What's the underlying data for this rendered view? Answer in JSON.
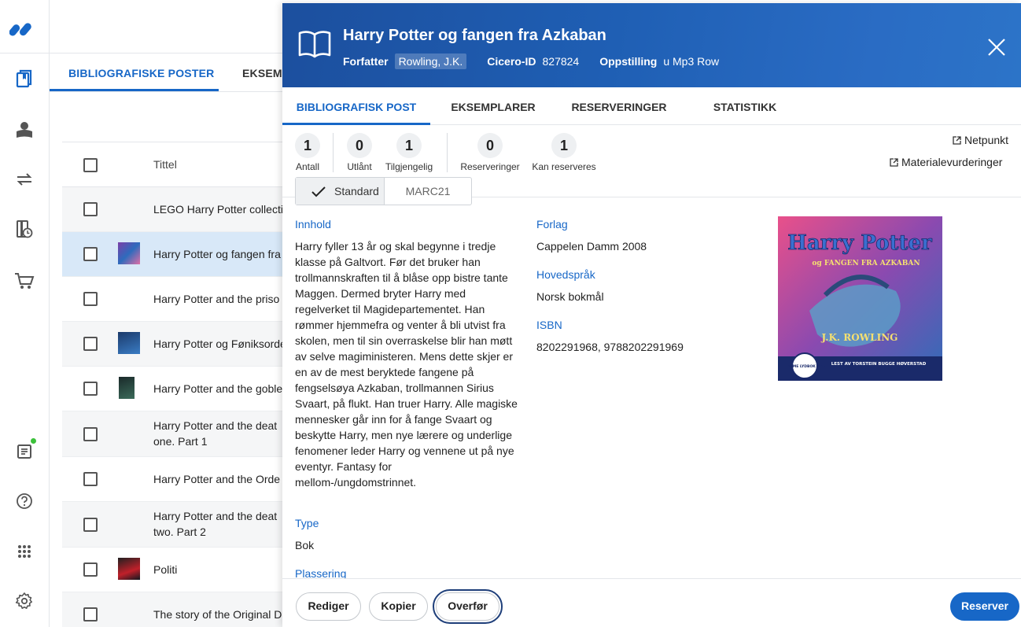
{
  "rail": {
    "icons": [
      "logo-icon",
      "catalog-icon",
      "patron-icon",
      "circulation-icon",
      "history-icon",
      "acquisition-icon",
      "report-icon",
      "help-icon",
      "apps-icon",
      "settings-icon"
    ]
  },
  "background": {
    "tabs": [
      "BIBLIOGRAFISKE POSTER",
      "EKSEMPLARER"
    ],
    "list_header": "Tittel",
    "rows": [
      {
        "title": "LEGO Harry Potter collecti",
        "line2": ""
      },
      {
        "title": "Harry Potter og fangen fra",
        "line2": ""
      },
      {
        "title": "Harry Potter and the priso",
        "line2": ""
      },
      {
        "title": "Harry Potter og Føniksorde",
        "line2": ""
      },
      {
        "title": "Harry Potter and the goble",
        "line2": ""
      },
      {
        "title": "Harry Potter and the deat",
        "line2": "one. Part 1"
      },
      {
        "title": "Harry Potter and the Orde",
        "line2": ""
      },
      {
        "title": "Harry Potter and the deat",
        "line2": "two. Part 2"
      },
      {
        "title": "Politi",
        "line2": ""
      },
      {
        "title": "The story of the Original D",
        "line2": ""
      }
    ]
  },
  "panel": {
    "title": "Harry Potter og fangen fra Azkaban",
    "meta": {
      "author_label": "Forfatter",
      "author": "Rowling, J.K.",
      "cicero_label": "Cicero-ID",
      "cicero_id": "827824",
      "placement_label": "Oppstilling",
      "placement": "u Mp3 Row"
    },
    "tabs": [
      "BIBLIOGRAFISK POST",
      "EKSEMPLARER",
      "RESERVERINGER",
      "STATISTIKK"
    ],
    "stats": [
      {
        "value": "1",
        "label": "Antall"
      },
      {
        "value": "0",
        "label": "Utlånt"
      },
      {
        "value": "1",
        "label": "Tilgjengelig"
      },
      {
        "value": "0",
        "label": "Reserveringer"
      },
      {
        "value": "1",
        "label": "Kan reserveres"
      }
    ],
    "links": {
      "netpunkt": "Netpunkt",
      "materialevurderinger": "Materialevurderinger"
    },
    "view_toggle": {
      "standard": "Standard",
      "marc": "MARC21"
    },
    "fields": {
      "innhold_label": "Innhold",
      "innhold_lines": [
        "Harry fyller 13 år og skal begynne i tredje",
        "klasse på Galtvort. Før det bruker han",
        "trollmannskraften til å blåse opp bistre tante",
        "Maggen. Dermed bryter Harry med",
        "regelverket til Magidepartementet. Han",
        "rømmer hjemmefra og venter å bli utvist fra",
        "skolen, men til sin overraskelse blir han møtt",
        "av selve magiministeren. Mens dette skjer er",
        "en av de mest beryktede fangene på",
        "fengselsøya Azkaban, trollmannen Sirius",
        "Svaart, på flukt. Han truer Harry. Alle magiske",
        "mennesker går inn for å fange Svaart og",
        "beskytte Harry, men nye lærere og underlige",
        "fenomener leder Harry og vennene ut på nye",
        "eventyr. Fantasy for",
        "mellom-/ungdomstrinnet."
      ],
      "forlag_label": "Forlag",
      "forlag": "Cappelen Damm 2008",
      "sprak_label": "Hovedspråk",
      "sprak": "Norsk bokmål",
      "isbn_label": "ISBN",
      "isbn": "8202291968, 9788202291969",
      "type_label": "Type",
      "type": "Bok",
      "plassering_label": "Plassering"
    },
    "cover": {
      "title_line1": "Harry Potter",
      "title_line2": "og FANGEN FRA AZKABAN",
      "author": "J.K. ROWLING",
      "narrator": "LEST AV TORSTEIN BUGGE HØVERSTAD",
      "badge": "LOMME LYDBOK MP3"
    },
    "buttons": {
      "rediger": "Rediger",
      "kopier": "Kopier",
      "overfor": "Overfør",
      "reserver": "Reserver"
    },
    "colors": {
      "accent": "#1767c7",
      "header": "#1f5fb4"
    }
  }
}
